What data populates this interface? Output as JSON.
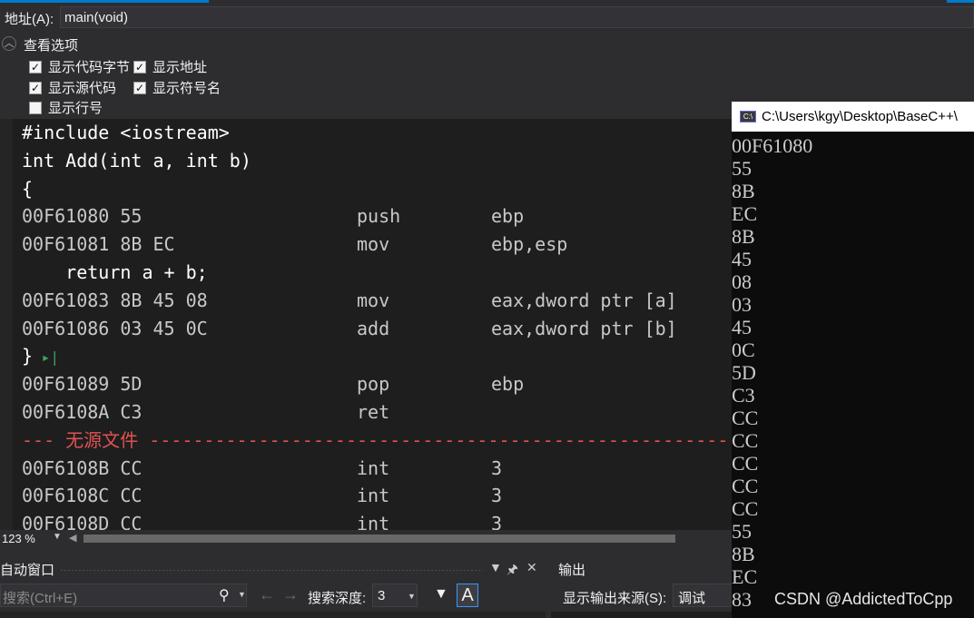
{
  "address": {
    "label": "地址(A):",
    "value": "main(void)"
  },
  "view_options": {
    "title": "查看选项",
    "checkboxes": [
      {
        "label": "显示代码字节",
        "checked": true
      },
      {
        "label": "显示地址",
        "checked": true
      },
      {
        "label": "显示源代码",
        "checked": true
      },
      {
        "label": "显示符号名",
        "checked": true
      },
      {
        "label": "显示行号",
        "checked": false
      }
    ]
  },
  "disassembly": {
    "lines": [
      {
        "kind": "src",
        "text": "#include <iostream>"
      },
      {
        "kind": "src",
        "text": "int Add(int a, int b)"
      },
      {
        "kind": "src",
        "text": "{"
      },
      {
        "kind": "asm",
        "addr": "00F61080",
        "bytes": "55",
        "op": "push",
        "operands": "ebp"
      },
      {
        "kind": "asm",
        "addr": "00F61081",
        "bytes": "8B EC",
        "op": "mov",
        "operands": "ebp,esp"
      },
      {
        "kind": "src",
        "text": "    return a + b;"
      },
      {
        "kind": "asm",
        "addr": "00F61083",
        "bytes": "8B 45 08",
        "op": "mov",
        "operands": "eax,dword ptr [a]"
      },
      {
        "kind": "asm",
        "addr": "00F61086",
        "bytes": "03 45 0C",
        "op": "add",
        "operands": "eax,dword ptr [b]"
      },
      {
        "kind": "src",
        "text": "}",
        "marker": "▸|"
      },
      {
        "kind": "asm",
        "addr": "00F61089",
        "bytes": "5D",
        "op": "pop",
        "operands": "ebp"
      },
      {
        "kind": "asm",
        "addr": "00F6108A",
        "bytes": "C3",
        "op": "ret",
        "operands": ""
      },
      {
        "kind": "nosrc",
        "text": "--- 无源文件 ------------------------------------------------------------"
      },
      {
        "kind": "asm",
        "addr": "00F6108B",
        "bytes": "CC",
        "op": "int",
        "operands": "3"
      },
      {
        "kind": "asm",
        "addr": "00F6108C",
        "bytes": "CC",
        "op": "int",
        "operands": "3"
      },
      {
        "kind": "asm",
        "addr": "00F6108D",
        "bytes": "CC",
        "op": "int",
        "operands": "3"
      }
    ]
  },
  "zoom": {
    "label": "123 %"
  },
  "autos": {
    "title": "自动窗口",
    "search_placeholder": "搜索(Ctrl+E)",
    "depth_label": "搜索深度:",
    "depth_value": "3",
    "a_button": "A"
  },
  "output": {
    "title": "输出",
    "source_label": "显示输出来源(S):",
    "source_value": "调试"
  },
  "console": {
    "title": "C:\\Users\\kgy\\Desktop\\BaseC++\\",
    "lines": [
      "00F61080",
      "55",
      "8B",
      "EC",
      "8B",
      "45",
      "08",
      "03",
      "45",
      "0C",
      "5D",
      "C3",
      "CC",
      "CC",
      "CC",
      "CC",
      "CC",
      "55",
      "8B",
      "EC",
      "83"
    ]
  },
  "watermark": "CSDN @AddictedToCpp",
  "icons": {
    "collapse": "chevron-up-icon",
    "search": "search-icon",
    "filter": "filter-icon",
    "pin": "pin-icon",
    "close": "close-icon",
    "console": "console-app-icon"
  },
  "colors": {
    "accent": "#007acc",
    "no_source": "#e05252",
    "breakpoint_marker": "#3fa35a",
    "editor_bg": "#1e1e1e",
    "console_bg": "#0c0c0c"
  }
}
